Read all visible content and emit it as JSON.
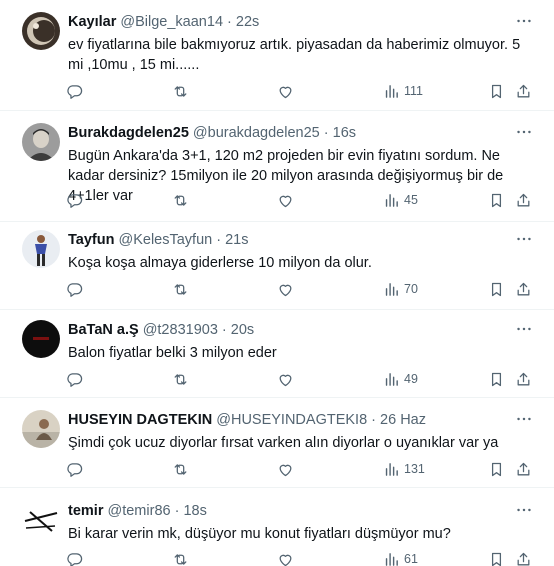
{
  "tweets": [
    {
      "name": "Kayılar",
      "handle": "@Bilge_kaan14",
      "time": "22s",
      "text": "ev fiyatlarına bile bakmıyoruz artık. piyasadan da haberimiz olmuyor. 5 mi ,10mu , 15 mi......",
      "views": "111",
      "avatar_color": "#5b4a3a"
    },
    {
      "name": "Burakdagdelen25",
      "handle": "@burakdagdelen25",
      "time": "16s",
      "text": "Bugün Ankara'da 3+1, 120 m2 projeden bir evin fiyatını sordum. Ne kadar dersiniz? 15milyon ile 20 milyon arasında değişiyormuş bir de 4+1ler var",
      "views": "45",
      "avatar_color": "#8a8a8a"
    },
    {
      "name": "Tayfun",
      "handle": "@KelesTayfun",
      "time": "21s",
      "text": "Koşa koşa almaya giderlerse 10 milyon da olur.",
      "views": "70",
      "avatar_color": "#6a7bb5"
    },
    {
      "name": "BaTaN a.Ş",
      "handle": "@t2831903",
      "time": "20s",
      "text": "Balon fiyatlar belki 3 milyon eder",
      "views": "49",
      "avatar_color": "#111111"
    },
    {
      "name": "HUSEYIN DAGTEKIN",
      "handle": "@HUSEYINDAGTEKI8",
      "time": "26 Haz",
      "text": "Şimdi çok ucuz diyorlar fırsat varken alın diyorlar o uyanıklar var ya",
      "views": "131",
      "avatar_color": "#c9c2b4"
    },
    {
      "name": "temir",
      "handle": "@temir86",
      "time": "18s",
      "text": "Bi karar verin mk, düşüyor mu konut fiyatları düşmüyor mu?",
      "views": "61",
      "avatar_color": "#ffffff"
    }
  ],
  "separator": "·",
  "colors": {
    "text": "#0f1419",
    "muted": "#536471",
    "divider": "#eff3f4"
  },
  "icons": [
    "more-icon",
    "reply-icon",
    "retweet-icon",
    "like-icon",
    "views-icon",
    "bookmark-icon",
    "share-icon"
  ]
}
